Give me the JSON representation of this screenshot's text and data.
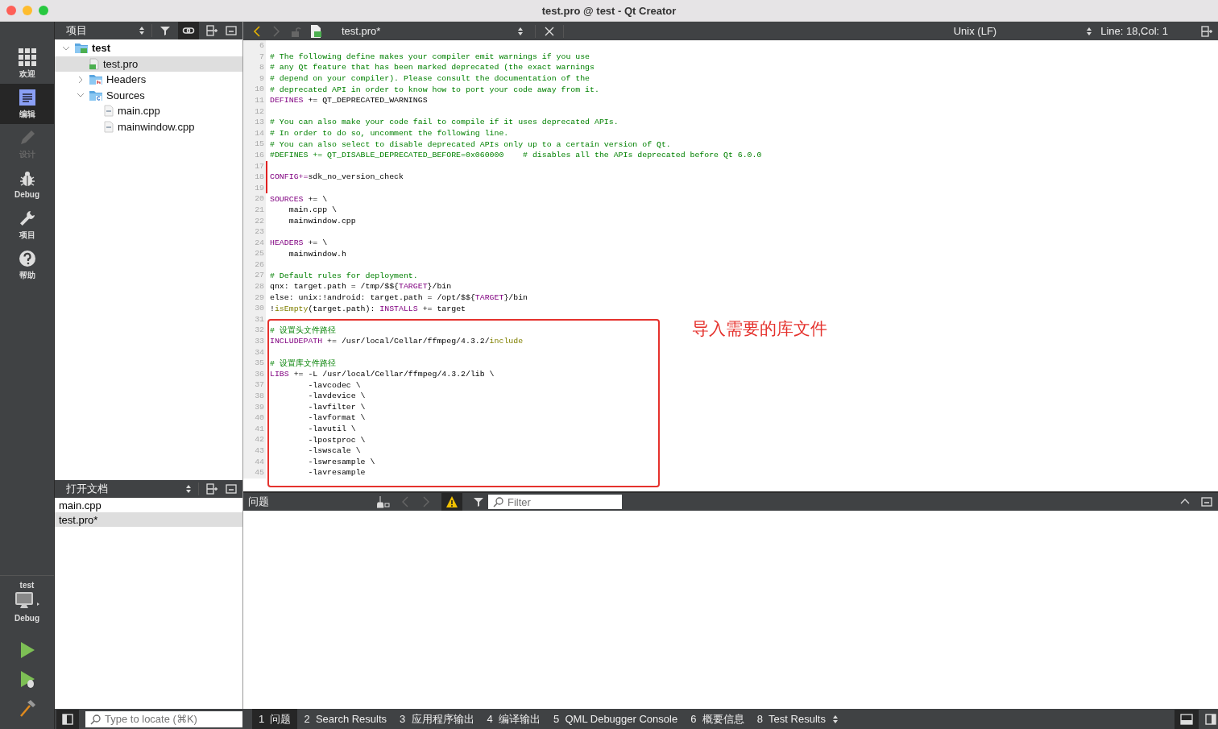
{
  "window": {
    "title": "test.pro @ test - Qt Creator"
  },
  "modes": [
    {
      "label": "欢迎",
      "kind": "welcome",
      "selected": false,
      "disabled": false
    },
    {
      "label": "编辑",
      "kind": "edit",
      "selected": true,
      "disabled": false
    },
    {
      "label": "设计",
      "kind": "design",
      "selected": false,
      "disabled": true
    },
    {
      "label": "Debug",
      "kind": "debug",
      "selected": false,
      "disabled": false
    },
    {
      "label": "项目",
      "kind": "projects",
      "selected": false,
      "disabled": false
    },
    {
      "label": "帮助",
      "kind": "help",
      "selected": false,
      "disabled": false
    }
  ],
  "kit": {
    "project": "test",
    "build": "Debug"
  },
  "run_buttons": [
    {
      "kind": "run"
    },
    {
      "kind": "debug-run"
    },
    {
      "kind": "build"
    }
  ],
  "projects_pane": {
    "title": "项目",
    "tree": [
      {
        "label": "test",
        "kind": "project",
        "selected": false,
        "expanded": true,
        "children": [
          {
            "label": "test.pro",
            "kind": "pro-file",
            "selected": true
          },
          {
            "label": "Headers",
            "kind": "headers-folder",
            "selected": false,
            "expanded": false
          },
          {
            "label": "Sources",
            "kind": "sources-folder",
            "selected": false,
            "expanded": true,
            "children": [
              {
                "label": "main.cpp",
                "kind": "cpp-file",
                "selected": false
              },
              {
                "label": "mainwindow.cpp",
                "kind": "cpp-file",
                "selected": false
              }
            ]
          }
        ]
      }
    ]
  },
  "open_documents": {
    "title": "打开文档",
    "items": [
      {
        "label": "main.cpp",
        "selected": false
      },
      {
        "label": "test.pro*",
        "selected": true
      }
    ]
  },
  "editor": {
    "file": "test.pro*",
    "line_ending": "Unix (LF)",
    "position": "Line: 18,Col: 1",
    "annotation": "导入需要的库文件",
    "lines": [
      {
        "n": "6",
        "modified": false
      },
      {
        "n": "7",
        "modified": false,
        "tokens": [
          {
            "kind": "comment",
            "text": "# The following define makes your compiler emit warnings if you use"
          }
        ]
      },
      {
        "n": "8",
        "modified": false,
        "tokens": [
          {
            "kind": "comment",
            "text": "# any Qt feature that has been marked deprecated (the exact warnings"
          }
        ]
      },
      {
        "n": "9",
        "modified": false,
        "tokens": [
          {
            "kind": "comment",
            "text": "# depend on your compiler). Please consult the documentation of the"
          }
        ]
      },
      {
        "n": "10",
        "modified": false,
        "tokens": [
          {
            "kind": "comment",
            "text": "# deprecated API in order to know how to port your code away from it."
          }
        ]
      },
      {
        "n": "11",
        "modified": false,
        "tokens": [
          {
            "kind": "keyword",
            "text": "DEFINES"
          },
          {
            "kind": "plain",
            "text": " += QT_DEPRECATED_WARNINGS"
          }
        ]
      },
      {
        "n": "12",
        "modified": false
      },
      {
        "n": "13",
        "modified": false,
        "tokens": [
          {
            "kind": "comment",
            "text": "# You can also make your code fail to compile if it uses deprecated APIs."
          }
        ]
      },
      {
        "n": "14",
        "modified": false,
        "tokens": [
          {
            "kind": "comment",
            "text": "# In order to do so, uncomment the following line."
          }
        ]
      },
      {
        "n": "15",
        "modified": false,
        "tokens": [
          {
            "kind": "comment",
            "text": "# You can also select to disable deprecated APIs only up to a certain version of Qt."
          }
        ]
      },
      {
        "n": "16",
        "modified": false,
        "tokens": [
          {
            "kind": "comment",
            "text": "#DEFINES += QT_DISABLE_DEPRECATED_BEFORE=0x060000    # disables all the APIs deprecated before Qt 6.0.0"
          }
        ]
      },
      {
        "n": "17",
        "modified": true
      },
      {
        "n": "18",
        "modified": true,
        "tokens": [
          {
            "kind": "keyword",
            "text": "CONFIG+="
          },
          {
            "kind": "plain",
            "text": "sdk_no_version_check"
          }
        ]
      },
      {
        "n": "19",
        "modified": true
      },
      {
        "n": "20",
        "modified": false,
        "tokens": [
          {
            "kind": "keyword",
            "text": "SOURCES"
          },
          {
            "kind": "plain",
            "text": " += \\"
          }
        ]
      },
      {
        "n": "21",
        "modified": false,
        "tokens": [
          {
            "kind": "plain",
            "text": "    main.cpp \\"
          }
        ]
      },
      {
        "n": "22",
        "modified": false,
        "tokens": [
          {
            "kind": "plain",
            "text": "    mainwindow.cpp"
          }
        ]
      },
      {
        "n": "23",
        "modified": false
      },
      {
        "n": "24",
        "modified": false,
        "tokens": [
          {
            "kind": "keyword",
            "text": "HEADERS"
          },
          {
            "kind": "plain",
            "text": " += \\"
          }
        ]
      },
      {
        "n": "25",
        "modified": false,
        "tokens": [
          {
            "kind": "plain",
            "text": "    mainwindow.h"
          }
        ]
      },
      {
        "n": "26",
        "modified": false
      },
      {
        "n": "27",
        "modified": false,
        "tokens": [
          {
            "kind": "comment",
            "text": "# Default rules for deployment."
          }
        ]
      },
      {
        "n": "28",
        "modified": false,
        "tokens": [
          {
            "kind": "plain",
            "text": "qnx: target.path = /tmp/$${"
          },
          {
            "kind": "keyword",
            "text": "TARGET"
          },
          {
            "kind": "plain",
            "text": "}/bin"
          }
        ]
      },
      {
        "n": "29",
        "modified": false,
        "tokens": [
          {
            "kind": "plain",
            "text": "else: unix:!android: target.path = /opt/$${"
          },
          {
            "kind": "keyword",
            "text": "TARGET"
          },
          {
            "kind": "plain",
            "text": "}/bin"
          }
        ]
      },
      {
        "n": "30",
        "modified": false,
        "tokens": [
          {
            "kind": "plain",
            "text": "!"
          },
          {
            "kind": "function",
            "text": "isEmpty"
          },
          {
            "kind": "plain",
            "text": "(target.path): "
          },
          {
            "kind": "keyword",
            "text": "INSTALLS"
          },
          {
            "kind": "plain",
            "text": " += target"
          }
        ]
      },
      {
        "n": "31",
        "modified": false
      },
      {
        "n": "32",
        "modified": false,
        "tokens": [
          {
            "kind": "comment",
            "text": "# 设置头文件路径"
          }
        ]
      },
      {
        "n": "33",
        "modified": false,
        "tokens": [
          {
            "kind": "keyword",
            "text": "INCLUDEPATH"
          },
          {
            "kind": "plain",
            "text": " += /usr/local/Cellar/ffmpeg/4.3.2/"
          },
          {
            "kind": "function",
            "text": "include"
          }
        ]
      },
      {
        "n": "34",
        "modified": false
      },
      {
        "n": "35",
        "modified": false,
        "tokens": [
          {
            "kind": "comment",
            "text": "# 设置库文件路径"
          }
        ]
      },
      {
        "n": "36",
        "modified": false,
        "tokens": [
          {
            "kind": "keyword",
            "text": "LIBS"
          },
          {
            "kind": "plain",
            "text": " += -L /usr/local/Cellar/ffmpeg/4.3.2/lib \\"
          }
        ]
      },
      {
        "n": "37",
        "modified": false,
        "tokens": [
          {
            "kind": "plain",
            "text": "        -lavcodec \\"
          }
        ]
      },
      {
        "n": "38",
        "modified": false,
        "tokens": [
          {
            "kind": "plain",
            "text": "        -lavdevice \\"
          }
        ]
      },
      {
        "n": "39",
        "modified": false,
        "tokens": [
          {
            "kind": "plain",
            "text": "        -lavfilter \\"
          }
        ]
      },
      {
        "n": "40",
        "modified": false,
        "tokens": [
          {
            "kind": "plain",
            "text": "        -lavformat \\"
          }
        ]
      },
      {
        "n": "41",
        "modified": false,
        "tokens": [
          {
            "kind": "plain",
            "text": "        -lavutil \\"
          }
        ]
      },
      {
        "n": "42",
        "modified": false,
        "tokens": [
          {
            "kind": "plain",
            "text": "        -lpostproc \\"
          }
        ]
      },
      {
        "n": "43",
        "modified": false,
        "tokens": [
          {
            "kind": "plain",
            "text": "        -lswscale \\"
          }
        ]
      },
      {
        "n": "44",
        "modified": false,
        "tokens": [
          {
            "kind": "plain",
            "text": "        -lswresample \\"
          }
        ]
      },
      {
        "n": "45",
        "modified": false,
        "tokens": [
          {
            "kind": "plain",
            "text": "        -lavresample"
          }
        ]
      }
    ]
  },
  "issues": {
    "title": "问题",
    "filter_placeholder": "Filter"
  },
  "locator": {
    "placeholder": "Type to locate (⌘K)"
  },
  "output_tabs": [
    {
      "number": "1",
      "label": "问题",
      "selected": true
    },
    {
      "number": "2",
      "label": "Search Results",
      "selected": false
    },
    {
      "number": "3",
      "label": "应用程序输出",
      "selected": false
    },
    {
      "number": "4",
      "label": "编译输出",
      "selected": false
    },
    {
      "number": "5",
      "label": "QML Debugger Console",
      "selected": false
    },
    {
      "number": "6",
      "label": "概要信息",
      "selected": false
    },
    {
      "number": "8",
      "label": "Test Results",
      "selected": false
    }
  ]
}
